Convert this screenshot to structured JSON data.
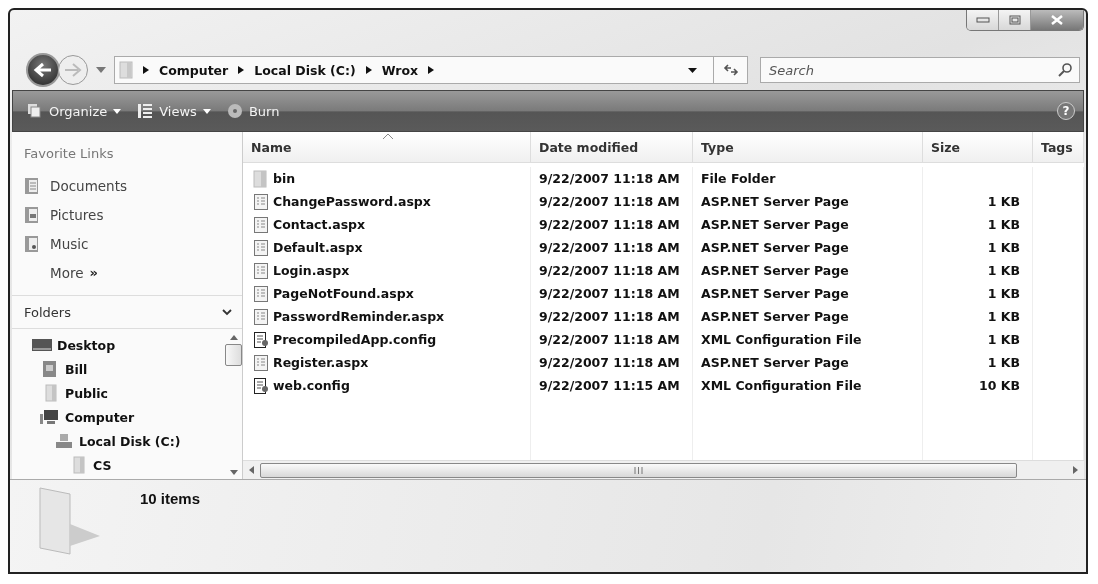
{
  "address_bar": {
    "crumbs": [
      "Computer",
      "Local Disk (C:)",
      "Wrox"
    ]
  },
  "search": {
    "placeholder": "Search"
  },
  "toolbar": {
    "buttons": [
      {
        "label": "Organize",
        "kind": "organize",
        "dropdown": true
      },
      {
        "label": "Views",
        "kind": "views",
        "dropdown": true
      },
      {
        "label": "Burn",
        "kind": "burn",
        "dropdown": false
      }
    ]
  },
  "help": {
    "label": "?"
  },
  "sidebar": {
    "favorites_title": "Favorite Links",
    "favorites": [
      {
        "label": "Documents",
        "kind": "documents"
      },
      {
        "label": "Pictures",
        "kind": "pictures"
      },
      {
        "label": "Music",
        "kind": "music"
      }
    ],
    "more": {
      "label": "More",
      "chevron": "»"
    },
    "folders_title": "Folders",
    "tree": [
      {
        "label": "Desktop",
        "kind": "desktop",
        "children": [
          {
            "label": "Bill",
            "kind": "user"
          },
          {
            "label": "Public",
            "kind": "folder"
          },
          {
            "label": "Computer",
            "kind": "computer",
            "children": [
              {
                "label": "Local Disk (C:)",
                "kind": "disk",
                "children": [
                  {
                    "label": "CS",
                    "kind": "folder"
                  }
                ]
              }
            ]
          }
        ]
      }
    ]
  },
  "table": {
    "columns": [
      "Name",
      "Date modified",
      "Type",
      "Size",
      "Tags"
    ],
    "rows": [
      {
        "kind": "folder",
        "name": "bin",
        "date": "9/22/2007 11:18 AM",
        "type": "File Folder"
      },
      {
        "kind": "aspx",
        "name": "ChangePassword.aspx",
        "date": "9/22/2007 11:18 AM",
        "type": "ASP.NET Server Page",
        "size": "1 KB"
      },
      {
        "kind": "aspx",
        "name": "Contact.aspx",
        "date": "9/22/2007 11:18 AM",
        "type": "ASP.NET Server Page",
        "size": "1 KB"
      },
      {
        "kind": "aspx",
        "name": "Default.aspx",
        "date": "9/22/2007 11:18 AM",
        "type": "ASP.NET Server Page",
        "size": "1 KB"
      },
      {
        "kind": "aspx",
        "name": "Login.aspx",
        "date": "9/22/2007 11:18 AM",
        "type": "ASP.NET Server Page",
        "size": "1 KB"
      },
      {
        "kind": "aspx",
        "name": "PageNotFound.aspx",
        "date": "9/22/2007 11:18 AM",
        "type": "ASP.NET Server Page",
        "size": "1 KB"
      },
      {
        "kind": "aspx",
        "name": "PasswordReminder.aspx",
        "date": "9/22/2007 11:18 AM",
        "type": "ASP.NET Server Page",
        "size": "1 KB"
      },
      {
        "kind": "config",
        "name": "PrecompiledApp.config",
        "date": "9/22/2007 11:18 AM",
        "type": "XML Configuration File",
        "size": "1 KB"
      },
      {
        "kind": "aspx",
        "name": "Register.aspx",
        "date": "9/22/2007 11:18 AM",
        "type": "ASP.NET Server Page",
        "size": "1 KB"
      },
      {
        "kind": "config",
        "name": "web.config",
        "date": "9/22/2007 11:15 AM",
        "type": "XML Configuration File",
        "size": "10 KB"
      }
    ]
  },
  "details": {
    "count": "10 items"
  }
}
